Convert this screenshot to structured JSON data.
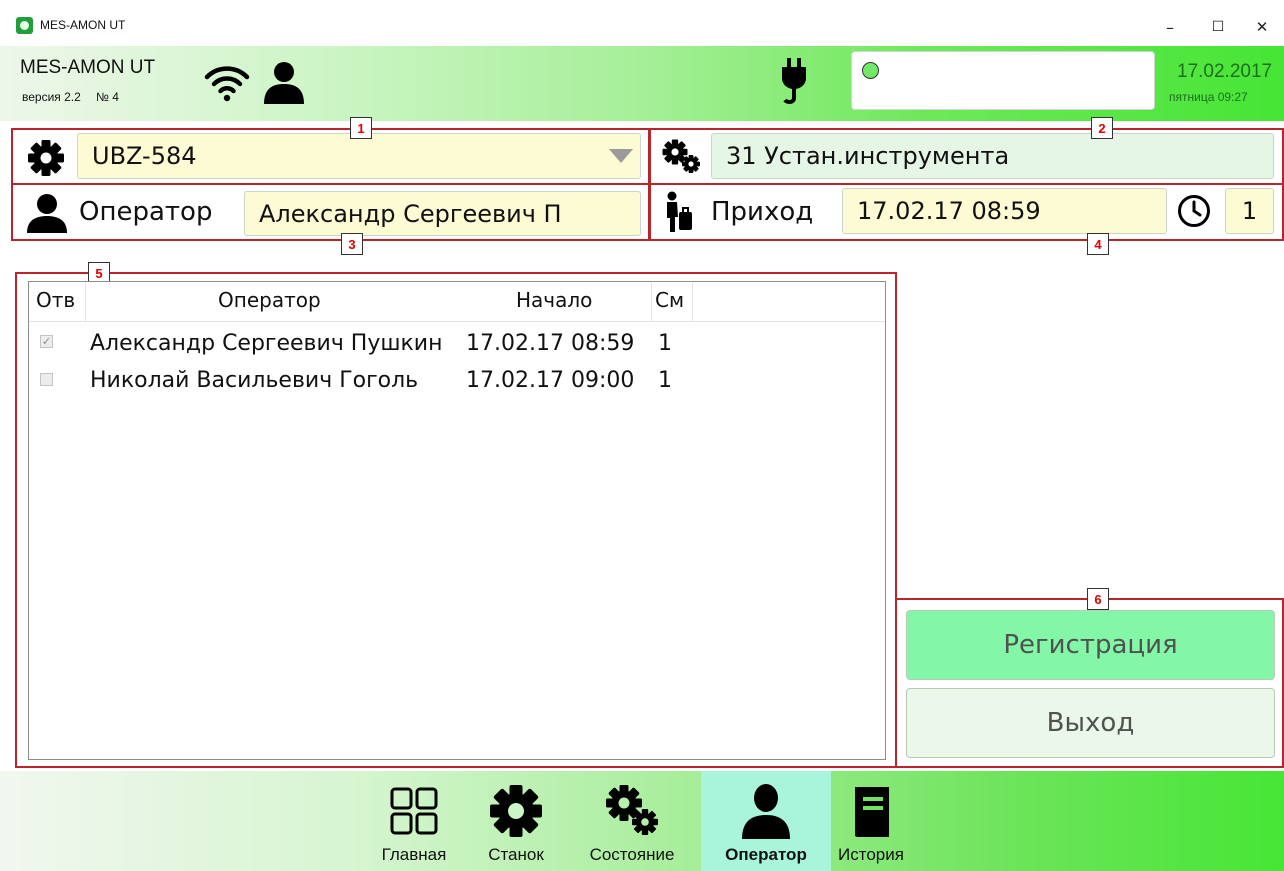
{
  "window": {
    "title": "MES-AMON UT",
    "minimize": "–",
    "maximize": "☐",
    "close": "✕"
  },
  "header": {
    "app_name": "MES-AMON UT",
    "version": "версия 2.2",
    "number": "№ 4",
    "status_message": "",
    "date": "17.02.2017",
    "weekday_time": "пятница 09:27",
    "status_led_color": "#74e86a"
  },
  "zones": {
    "z1": "1",
    "z2": "2",
    "z3": "3",
    "z4": "4",
    "z5": "5",
    "z6": "6"
  },
  "machine": {
    "value": "UBZ-584"
  },
  "state": {
    "value": "31 Устан.инструмента"
  },
  "operator": {
    "label": "Оператор",
    "value": "Александр Сергеевич П"
  },
  "arrival": {
    "label": "Приход",
    "value": "17.02.17 08:59",
    "shift": "1"
  },
  "table": {
    "headers": {
      "resp": "Отв",
      "operator": "Оператор",
      "start": "Начало",
      "shift": "См"
    },
    "rows": [
      {
        "checked": true,
        "check_mark": "✓",
        "operator": "Александр Сергеевич Пушкин",
        "start": "17.02.17 08:59",
        "shift": "1"
      },
      {
        "checked": false,
        "check_mark": "",
        "operator": "Николай Васильевич Гоголь",
        "start": "17.02.17 09:00",
        "shift": "1"
      }
    ]
  },
  "buttons": {
    "register": "Регистрация",
    "exit": "Выход"
  },
  "nav": {
    "items": [
      {
        "label": "Главная",
        "icon": "grid-icon"
      },
      {
        "label": "Станок",
        "icon": "gear-icon"
      },
      {
        "label": "Состояние",
        "icon": "gears-icon"
      },
      {
        "label": "Оператор",
        "icon": "user-icon",
        "active": true
      },
      {
        "label": "История",
        "icon": "book-icon"
      }
    ]
  },
  "colors": {
    "accent_green": "#46e535",
    "zone_red": "#b8262b",
    "zone_label_red": "#e00000",
    "register_button": "#84f6a8",
    "active_nav": "#a9f5dc"
  }
}
